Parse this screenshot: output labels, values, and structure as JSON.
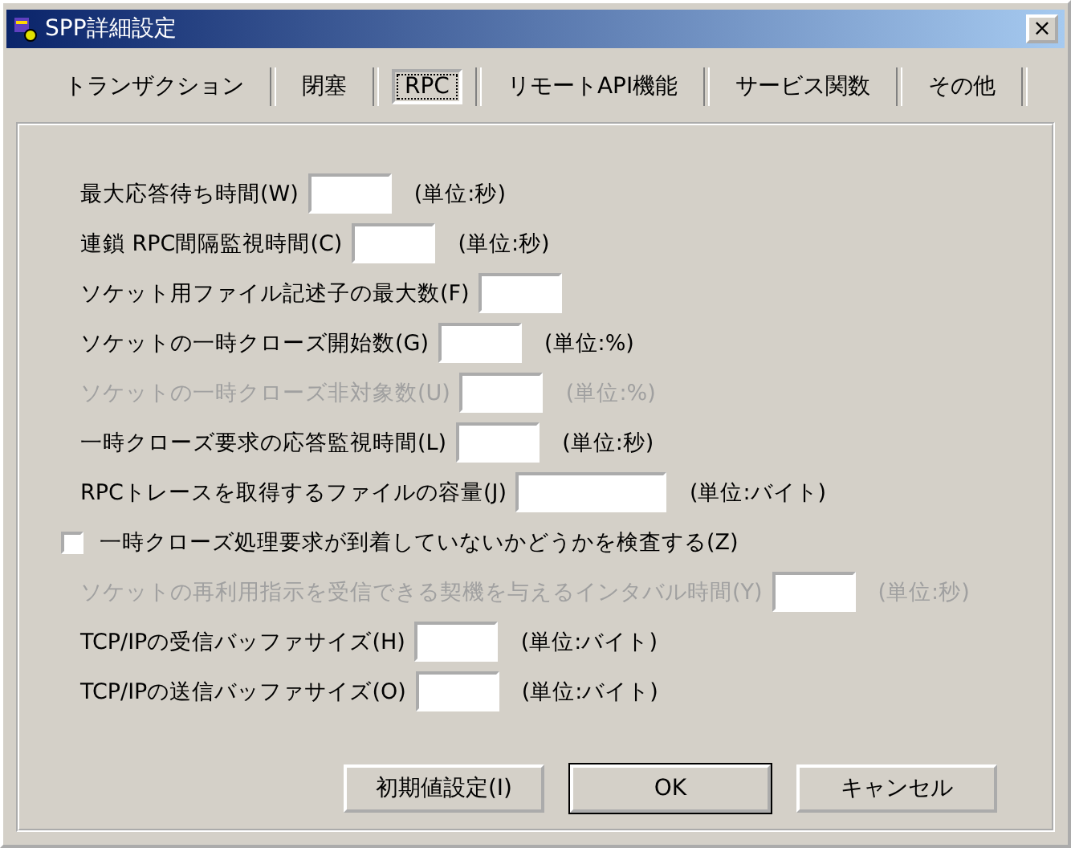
{
  "window": {
    "title": "SPP詳細設定",
    "close": "×"
  },
  "tabs": [
    {
      "label": "トランザクション",
      "selected": false
    },
    {
      "label": "閉塞",
      "selected": false
    },
    {
      "label": "RPC",
      "selected": true
    },
    {
      "label": "リモートAPI機能",
      "selected": false
    },
    {
      "label": "サービス関数",
      "selected": false
    },
    {
      "label": "その他",
      "selected": false
    }
  ],
  "rows": [
    {
      "kind": "field",
      "label": "最大応答待ち時間(W)",
      "unit": "(単位:秒)",
      "disabled": false,
      "wide": false
    },
    {
      "kind": "field",
      "label": "連鎖 RPC間隔監視時間(C)",
      "unit": "(単位:秒)",
      "disabled": false,
      "wide": false
    },
    {
      "kind": "field",
      "label": "ソケット用ファイル記述子の最大数(F)",
      "disabled": false,
      "wide": false
    },
    {
      "kind": "field",
      "label": "ソケットの一時クローズ開始数(G)",
      "unit": "(単位:%)",
      "disabled": false,
      "wide": false
    },
    {
      "kind": "field",
      "label": "ソケットの一時クローズ非対象数(U)",
      "unit": "(単位:%)",
      "disabled": true,
      "wide": false
    },
    {
      "kind": "field",
      "label": "一時クローズ要求の応答監視時間(L)",
      "unit": "(単位:秒)",
      "disabled": false,
      "wide": false
    },
    {
      "kind": "field",
      "label": "RPCトレースを取得するファイルの容量(J)",
      "unit": "(単位:バイト)",
      "disabled": false,
      "wide": true
    },
    {
      "kind": "checkbox",
      "label": "一時クローズ処理要求が到着していないかどうかを検査する(Z)",
      "checked": false
    },
    {
      "kind": "field",
      "label": "ソケットの再利用指示を受信できる契機を与えるインタバル時間(Y)",
      "unit": "(単位:秒)",
      "disabled": true,
      "wide": false
    },
    {
      "kind": "field",
      "label": "TCP/IPの受信バッファサイズ(H)",
      "unit": "(単位:バイト)",
      "disabled": false,
      "wide": false
    },
    {
      "kind": "field",
      "label": "TCP/IPの送信バッファサイズ(O)",
      "unit": "(単位:バイト)",
      "disabled": false,
      "wide": false
    }
  ],
  "buttons": [
    {
      "label": "初期値設定(I)",
      "default": false
    },
    {
      "label": "OK",
      "default": true
    },
    {
      "label": "キャンセル",
      "default": false
    }
  ]
}
